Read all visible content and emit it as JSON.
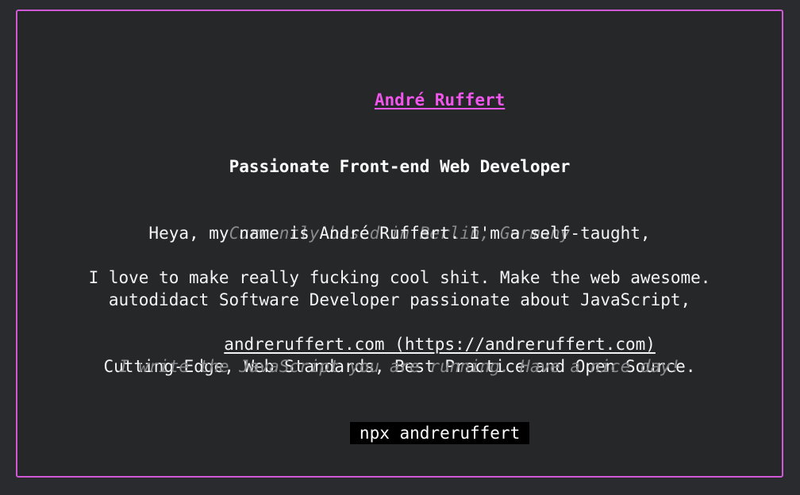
{
  "colors": {
    "background": "#2a2b2e",
    "card": "#262729",
    "border": "#d058d6",
    "name": "#f056ec",
    "text": "#f4f4f4",
    "muted": "#8a8b8e",
    "command_bg": "#000000"
  },
  "card": {
    "name": "André Ruffert",
    "role": "Passionate Front-end Web Developer",
    "location": "Currently based in Berlin, Germany",
    "bio": [
      "Heya, my name is André Ruffert. I'm a self-taught,",
      "autodidact Software Developer passionate about JavaScript,",
      "Cutting-Edge, Web Standards, Best Practice and Open Source."
    ],
    "love": "I love to make really fucking cool shit. Make the web awesome.",
    "link": "andreruffert.com (https://andreruffert.com)",
    "tagline": "I write the JavaScript you are running. Have a nice day!",
    "command": "npx andreruffert"
  }
}
